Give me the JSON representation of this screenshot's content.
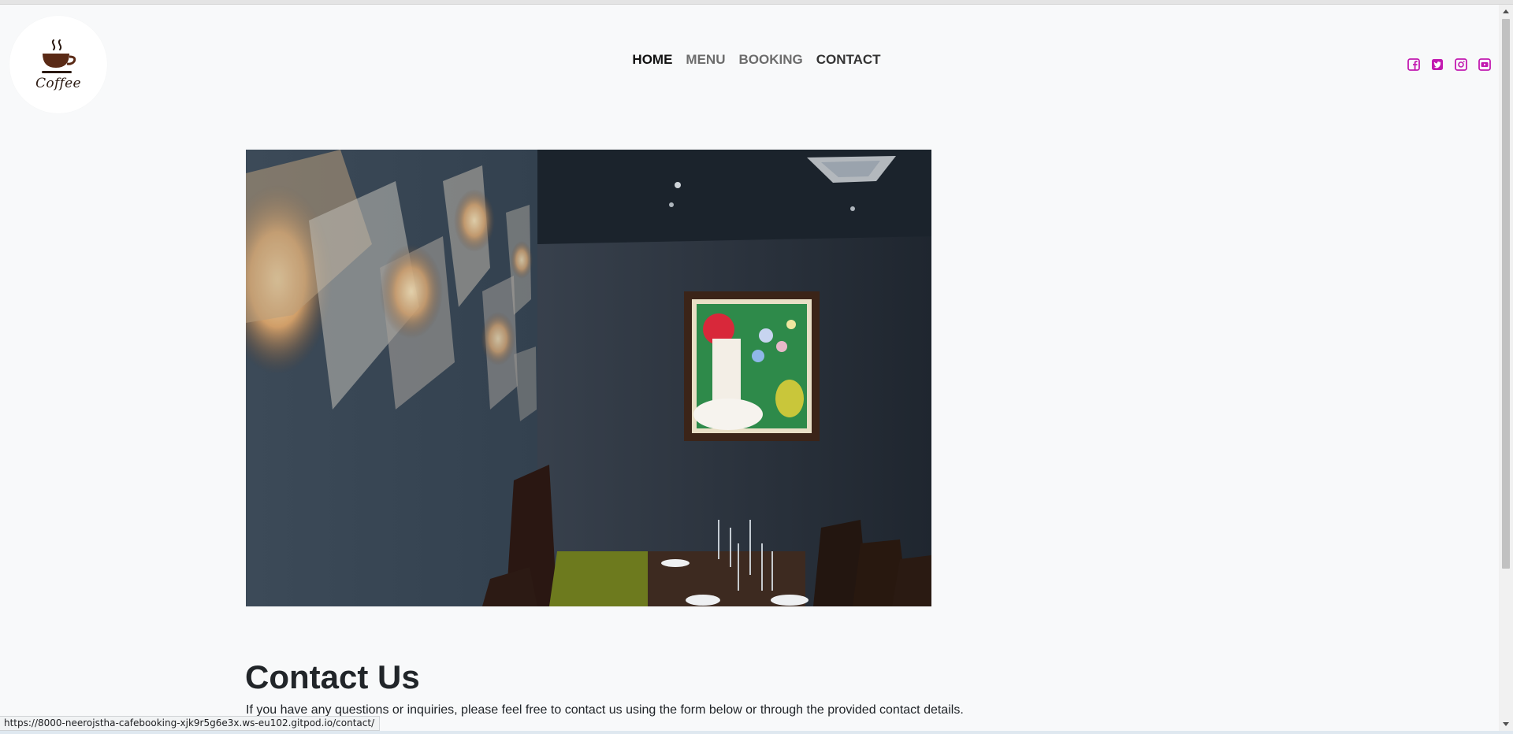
{
  "logo": {
    "text": "Coffee",
    "icon": "coffee-cup-icon"
  },
  "nav": {
    "items": [
      {
        "label": "HOME",
        "state": "active"
      },
      {
        "label": "MENU",
        "state": "normal"
      },
      {
        "label": "BOOKING",
        "state": "normal"
      },
      {
        "label": "CONTACT",
        "state": "hover"
      }
    ]
  },
  "social": {
    "color": "#c21ab0",
    "icons": [
      "facebook-icon",
      "twitter-icon",
      "instagram-icon",
      "youtube-icon"
    ]
  },
  "hero": {
    "image": "restaurant-interior-photo"
  },
  "contact": {
    "title": "Contact Us",
    "description": "If you have any questions or inquiries, please feel free to contact us using the form below or through the provided contact details."
  },
  "status_bar": {
    "url": "https://8000-neerojstha-cafebooking-xjk9r5g6e3x.ws-eu102.gitpod.io/contact/"
  }
}
